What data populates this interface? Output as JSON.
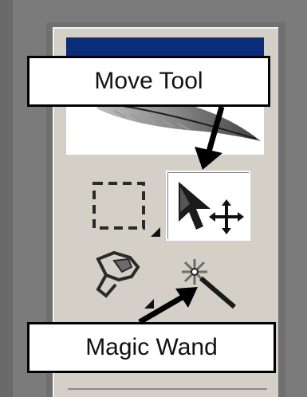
{
  "callouts": {
    "move": "Move Tool",
    "wand": "Magic Wand"
  },
  "tools": [
    {
      "name": "Rectangular Marquee",
      "icon": "marquee-icon"
    },
    {
      "name": "Move",
      "icon": "move-icon",
      "selected": true
    },
    {
      "name": "Lasso",
      "icon": "lasso-icon"
    },
    {
      "name": "Magic Wand",
      "icon": "magic-wand-icon"
    }
  ],
  "colors": {
    "palette": "#d4d0c8",
    "title_bar": "#0a2c7b",
    "background": "#7b7b7b"
  }
}
